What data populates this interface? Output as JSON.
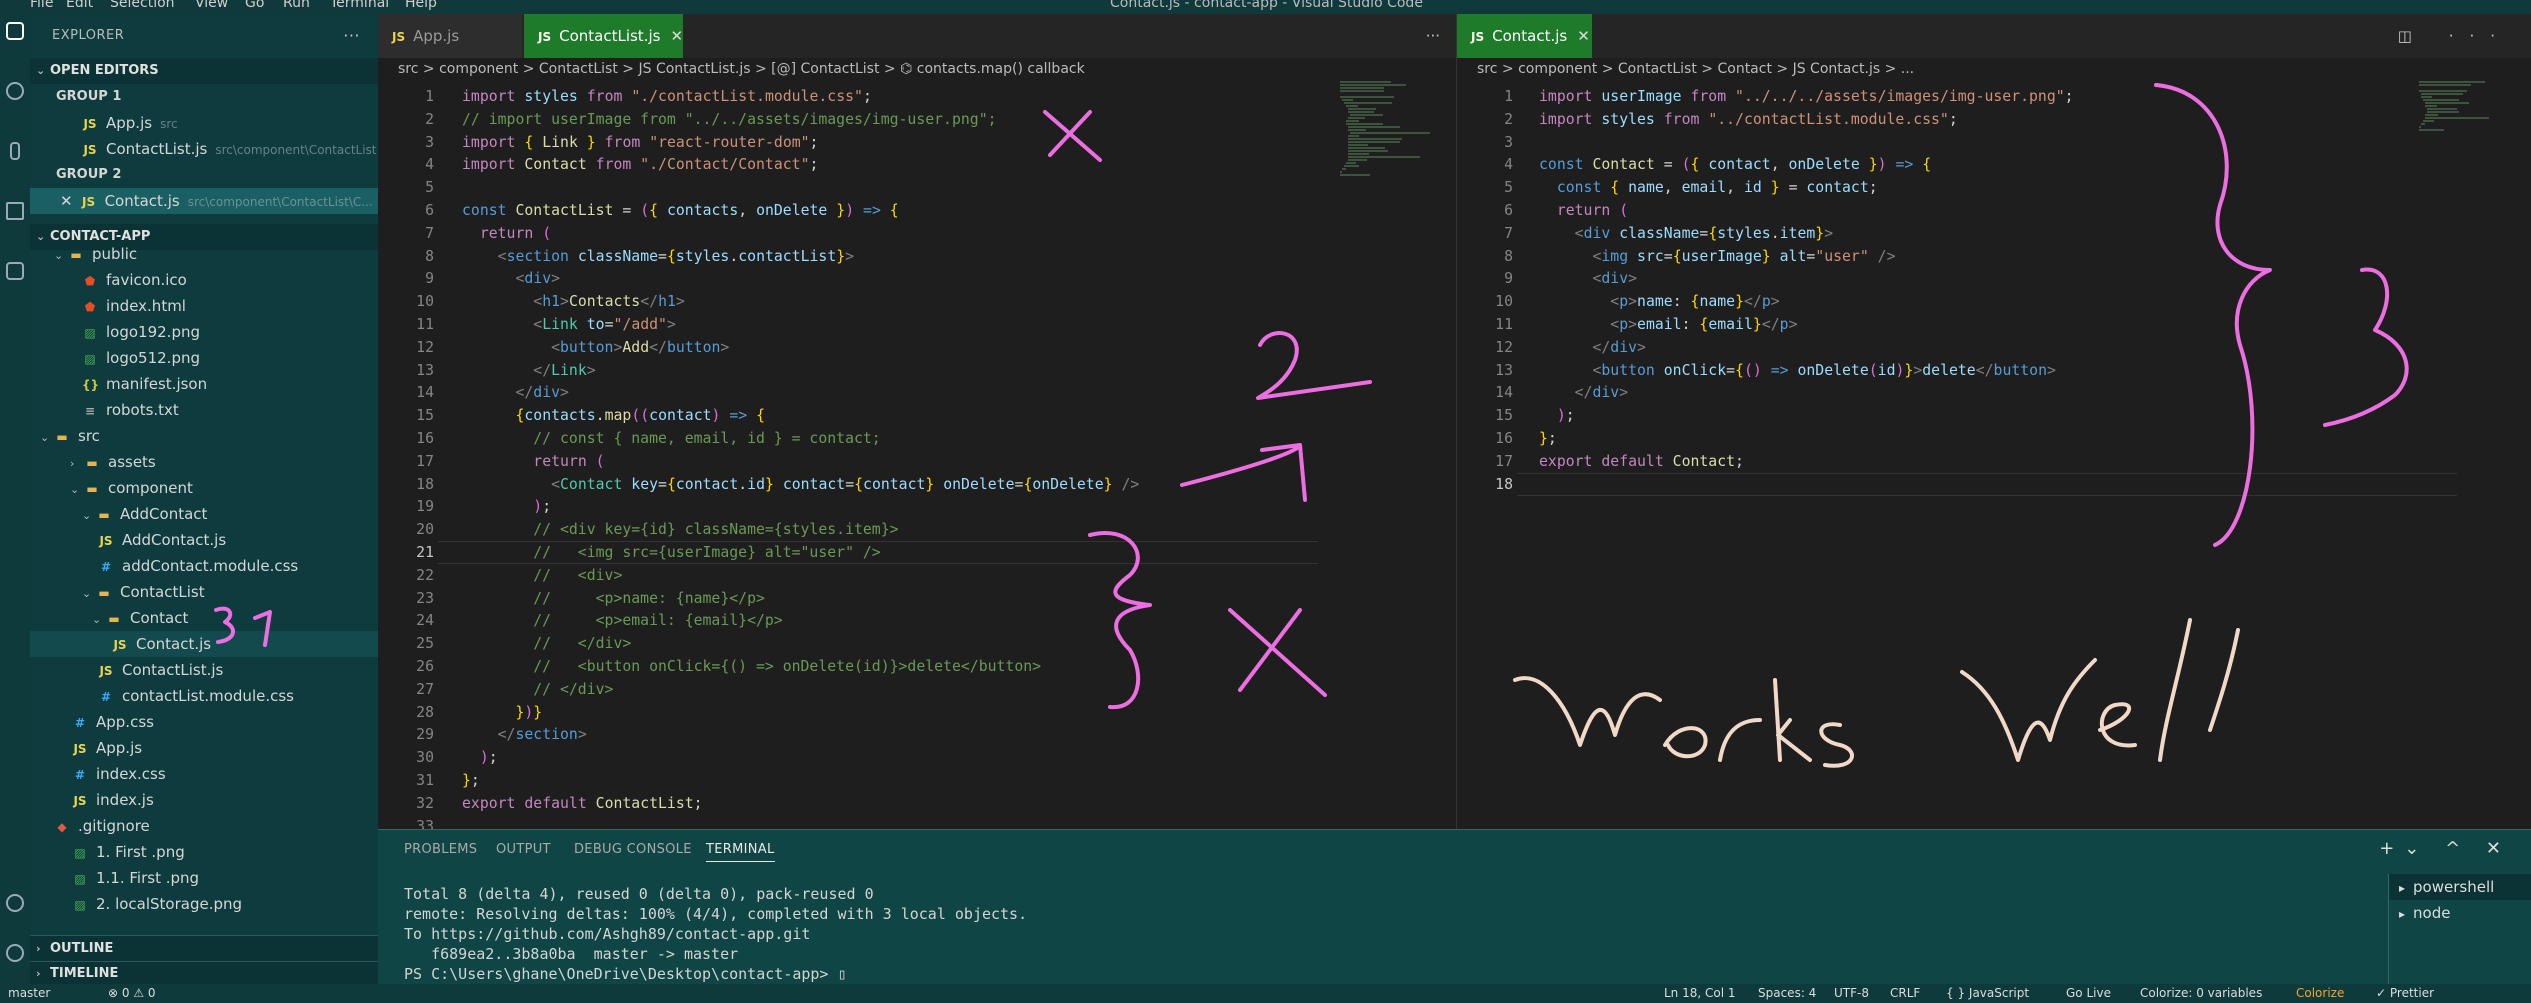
{
  "window": {
    "title": "Contact.js - contact-app - Visual Studio Code",
    "menu": [
      "File",
      "Edit",
      "Selection",
      "View",
      "Go",
      "Run",
      "Terminal",
      "Help"
    ]
  },
  "sidebar": {
    "title": "EXPLORER",
    "open_editors_label": "OPEN EDITORS",
    "group1_label": "GROUP 1",
    "group1_items": [
      {
        "name": "App.js",
        "path": "src"
      },
      {
        "name": "ContactList.js",
        "path": "src\\component\\ContactList"
      }
    ],
    "group2_label": "GROUP 2",
    "group2_items": [
      {
        "name": "Contact.js",
        "path": "src\\component\\ContactList\\C..."
      }
    ],
    "project_label": "CONTACT-APP",
    "tree": [
      {
        "name": "public",
        "kind": "folder"
      },
      {
        "name": "favicon.ico",
        "kind": "html"
      },
      {
        "name": "index.html",
        "kind": "html"
      },
      {
        "name": "logo192.png",
        "kind": "img"
      },
      {
        "name": "logo512.png",
        "kind": "img"
      },
      {
        "name": "manifest.json",
        "kind": "json"
      },
      {
        "name": "robots.txt",
        "kind": "txt"
      },
      {
        "name": "src",
        "kind": "folder"
      },
      {
        "name": "assets",
        "kind": "folder"
      },
      {
        "name": "component",
        "kind": "folder"
      },
      {
        "name": "AddContact",
        "kind": "folder"
      },
      {
        "name": "AddContact.js",
        "kind": "js"
      },
      {
        "name": "addContact.module.css",
        "kind": "css"
      },
      {
        "name": "ContactList",
        "kind": "folder"
      },
      {
        "name": "Contact",
        "kind": "folder"
      },
      {
        "name": "Contact.js",
        "kind": "js"
      },
      {
        "name": "ContactList.js",
        "kind": "js"
      },
      {
        "name": "contactList.module.css",
        "kind": "css"
      },
      {
        "name": "App.css",
        "kind": "css"
      },
      {
        "name": "App.js",
        "kind": "js"
      },
      {
        "name": "index.css",
        "kind": "css"
      },
      {
        "name": "index.js",
        "kind": "js"
      },
      {
        "name": ".gitignore",
        "kind": "git"
      },
      {
        "name": "1. First .png",
        "kind": "img"
      },
      {
        "name": "1.1. First .png",
        "kind": "img"
      },
      {
        "name": "2. localStorage.png",
        "kind": "img"
      }
    ],
    "outline_label": "OUTLINE",
    "timeline_label": "TIMELINE"
  },
  "editor1": {
    "tabs": [
      "App.js",
      "ContactList.js"
    ],
    "breadcrumb": "src > component > ContactList > JS ContactList.js > [@] ContactList > ⌬ contacts.map() callback",
    "lines": [
      "import styles from \"./contactList.module.css\";",
      "// import userImage from \"../../assets/images/img-user.png\";",
      "import { Link } from \"react-router-dom\";",
      "import Contact from \"./Contact/Contact\";",
      "",
      "const ContactList = ({ contacts, onDelete }) => {",
      "  return (",
      "    <section className={styles.contactList}>",
      "      <div>",
      "        <h1>Contacts</h1>",
      "        <Link to=\"/add\">",
      "          <button>Add</button>",
      "        </Link>",
      "      </div>",
      "      {contacts.map((contact) => {",
      "        // const { name, email, id } = contact;",
      "        return (",
      "          <Contact key={contact.id} contact={contact} onDelete={onDelete} />",
      "        );",
      "        // <div key={id} className={styles.item}>",
      "        //   <img src={userImage} alt=\"user\" />",
      "        //   <div>",
      "        //     <p>name: {name}</p>",
      "        //     <p>email: {email}</p>",
      "        //   </div>",
      "        //   <button onClick={() => onDelete(id)}>delete</button>",
      "        // </div>",
      "      })}",
      "    </section>",
      "  );",
      "};",
      "export default ContactList;",
      ""
    ]
  },
  "editor2": {
    "tab": "Contact.js",
    "breadcrumb": "src > component > ContactList > Contact > JS Contact.js > ...",
    "lines": [
      "import userImage from \"../../../assets/images/img-user.png\";",
      "import styles from \"../contactList.module.css\";",
      "",
      "const Contact = ({ contact, onDelete }) => {",
      "  const { name, email, id } = contact;",
      "  return (",
      "    <div className={styles.item}>",
      "      <img src={userImage} alt=\"user\" />",
      "      <div>",
      "        <p>name: {name}</p>",
      "        <p>email: {email}</p>",
      "      </div>",
      "      <button onClick={() => onDelete(id)}>delete</button>",
      "    </div>",
      "  );",
      "};",
      "export default Contact;",
      ""
    ]
  },
  "panel": {
    "tabs": [
      "PROBLEMS",
      "OUTPUT",
      "DEBUG CONSOLE",
      "TERMINAL"
    ],
    "terminal_lines": [
      "Total 8 (delta 4), reused 0 (delta 0), pack-reused 0",
      "remote: Resolving deltas: 100% (4/4), completed with 3 local objects.",
      "To https://github.com/Ashgh89/contact-app.git",
      "   f689ea2..3b8a0ba  master -> master",
      "PS C:\\Users\\ghane\\OneDrive\\Desktop\\contact-app> ▯"
    ],
    "terminals": [
      "powershell",
      "node"
    ]
  },
  "statusbar": {
    "branch": "master",
    "problems": "⊗ 0 ⚠ 0",
    "position": "Ln 18, Col 1",
    "spaces": "Spaces: 4",
    "encoding": "UTF-8",
    "eol": "CRLF",
    "language": "{ } JavaScript",
    "golive": "Go Live",
    "colorize_vars": "Colorize: 0 variables",
    "colorize": "Colorize",
    "prettier": "✓ Prettier"
  },
  "annotations": {
    "handwriting": "Works Well",
    "numerals": [
      "2",
      "3",
      "3",
      "1"
    ]
  }
}
